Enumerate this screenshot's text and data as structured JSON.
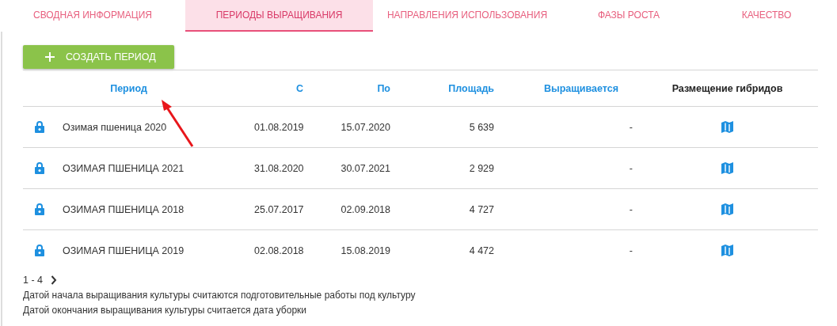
{
  "tabs": [
    {
      "label": "СВОДНАЯ ИНФОРМАЦИЯ",
      "selected": false
    },
    {
      "label": "ПЕРИОДЫ ВЫРАЩИВАНИЯ",
      "selected": true
    },
    {
      "label": "НАПРАВЛЕНИЯ ИСПОЛЬЗОВАНИЯ",
      "selected": false
    },
    {
      "label": "ФАЗЫ РОСТА",
      "selected": false
    },
    {
      "label": "КАЧЕСТВО",
      "selected": false
    }
  ],
  "create_button": {
    "label": "СОЗДАТЬ ПЕРИОД"
  },
  "table": {
    "columns": [
      {
        "label": "Период",
        "sortable": true
      },
      {
        "label": "С",
        "sortable": true
      },
      {
        "label": "По",
        "sortable": true
      },
      {
        "label": "Площадь",
        "sortable": true
      },
      {
        "label": "Выращивается",
        "sortable": true
      },
      {
        "label": "Размещение гибридов",
        "sortable": false
      }
    ],
    "rows": [
      {
        "locked": true,
        "period": "Озимая пшеница 2020",
        "from": "01.08.2019",
        "to": "15.07.2020",
        "area": "5 639",
        "growing": "-"
      },
      {
        "locked": true,
        "period": "ОЗИМАЯ ПШЕНИЦА 2021",
        "from": "31.08.2020",
        "to": "30.07.2021",
        "area": "2 929",
        "growing": "-"
      },
      {
        "locked": true,
        "period": "ОЗИМАЯ ПШЕНИЦА 2018",
        "from": "25.07.2017",
        "to": "02.09.2018",
        "area": "4 727",
        "growing": "-"
      },
      {
        "locked": true,
        "period": "ОЗИМАЯ ПШЕНИЦА 2019",
        "from": "02.08.2018",
        "to": "15.08.2019",
        "area": "4 472",
        "growing": "-"
      }
    ]
  },
  "pagination": {
    "range": "1 - 4"
  },
  "notes": [
    "Датой начала выращивания культуры считаются подготовительные работы под культуру",
    "Датой окончания выращивания культуры считается дата уборки"
  ]
}
